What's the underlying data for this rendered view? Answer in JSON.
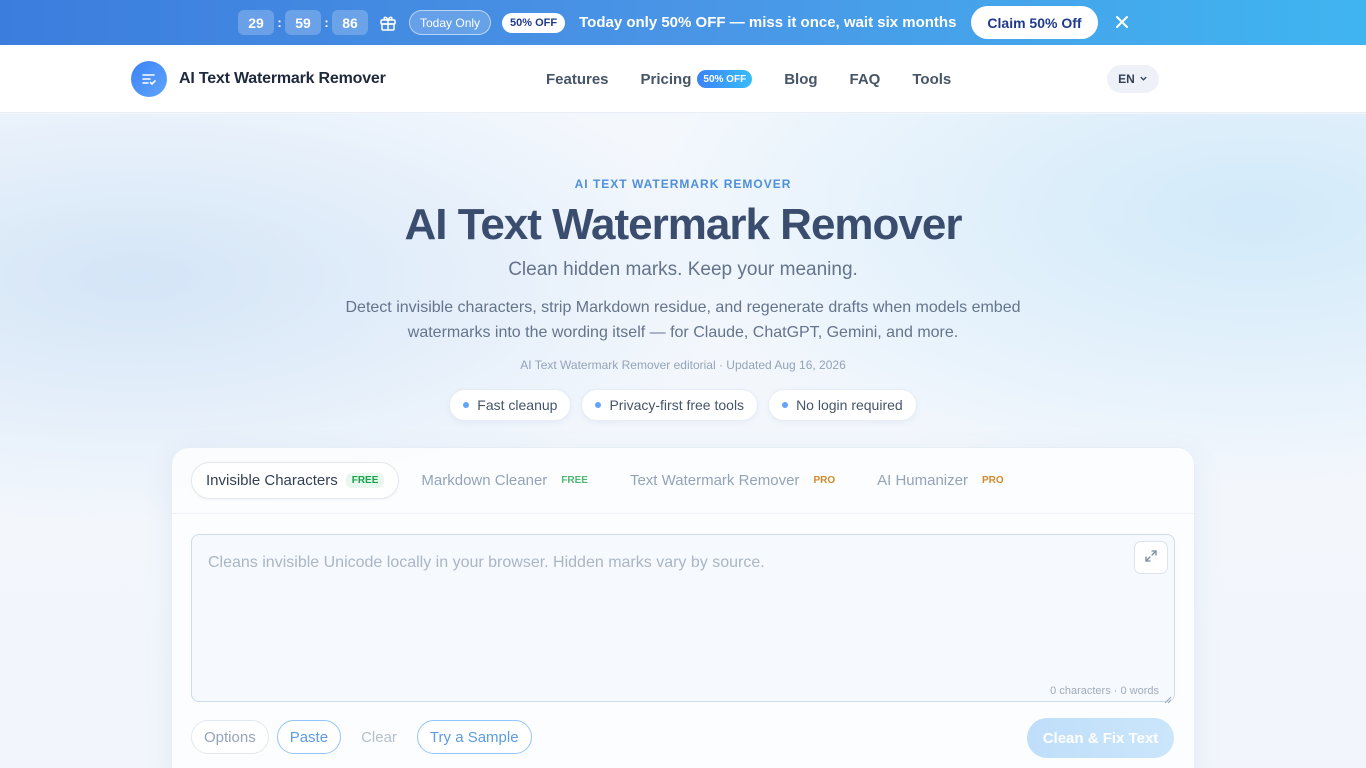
{
  "promo": {
    "timer": {
      "h": "29",
      "m": "59",
      "s": "86",
      "sep": ":"
    },
    "today_label": "Today Only",
    "off_badge": "50% OFF",
    "message": "Today only 50% OFF — miss it once, wait six months",
    "claim_label": "Claim 50% Off",
    "close_symbol": "✕",
    "colors": {
      "start": "#3b7ddd",
      "end": "#3fb5f0"
    }
  },
  "nav": {
    "brand": "AI Text Watermark Remover",
    "links": [
      {
        "label": "Features"
      },
      {
        "label": "Pricing",
        "badge": "50% OFF"
      },
      {
        "label": "Blog"
      },
      {
        "label": "FAQ"
      },
      {
        "label": "Tools"
      }
    ],
    "lang": "EN",
    "icons": {
      "logo": "text-lines-check-icon",
      "lang": "chevron-down-icon"
    }
  },
  "hero": {
    "eyebrow": "AI TEXT WATERMARK REMOVER",
    "title": "AI Text Watermark Remover",
    "subtitle": "Clean hidden marks. Keep your meaning.",
    "description": "Detect invisible characters, strip Markdown residue, and regenerate drafts when models embed watermarks into the wording itself — for Claude, ChatGPT, Gemini, and more.",
    "meta": "AI Text Watermark Remover editorial · Updated Aug 16, 2026",
    "pills": [
      "Fast cleanup",
      "Privacy-first free tools",
      "No login required"
    ]
  },
  "tool": {
    "tabs": [
      {
        "label": "Invisible Characters",
        "tag": "FREE",
        "active": true
      },
      {
        "label": "Markdown Cleaner",
        "tag": "FREE",
        "active": false
      },
      {
        "label": "Text Watermark Remover",
        "tag": "PRO",
        "active": false
      },
      {
        "label": "AI Humanizer",
        "tag": "PRO",
        "active": false
      }
    ],
    "editor": {
      "value": "",
      "placeholder": "Cleans invisible Unicode locally in your browser. Hidden marks vary by source.",
      "counter": "0 characters · 0 words"
    },
    "actions": {
      "options": "Options",
      "paste": "Paste",
      "clear": "Clear",
      "sample": "Try a Sample",
      "primary": "Clean & Fix Text"
    }
  }
}
